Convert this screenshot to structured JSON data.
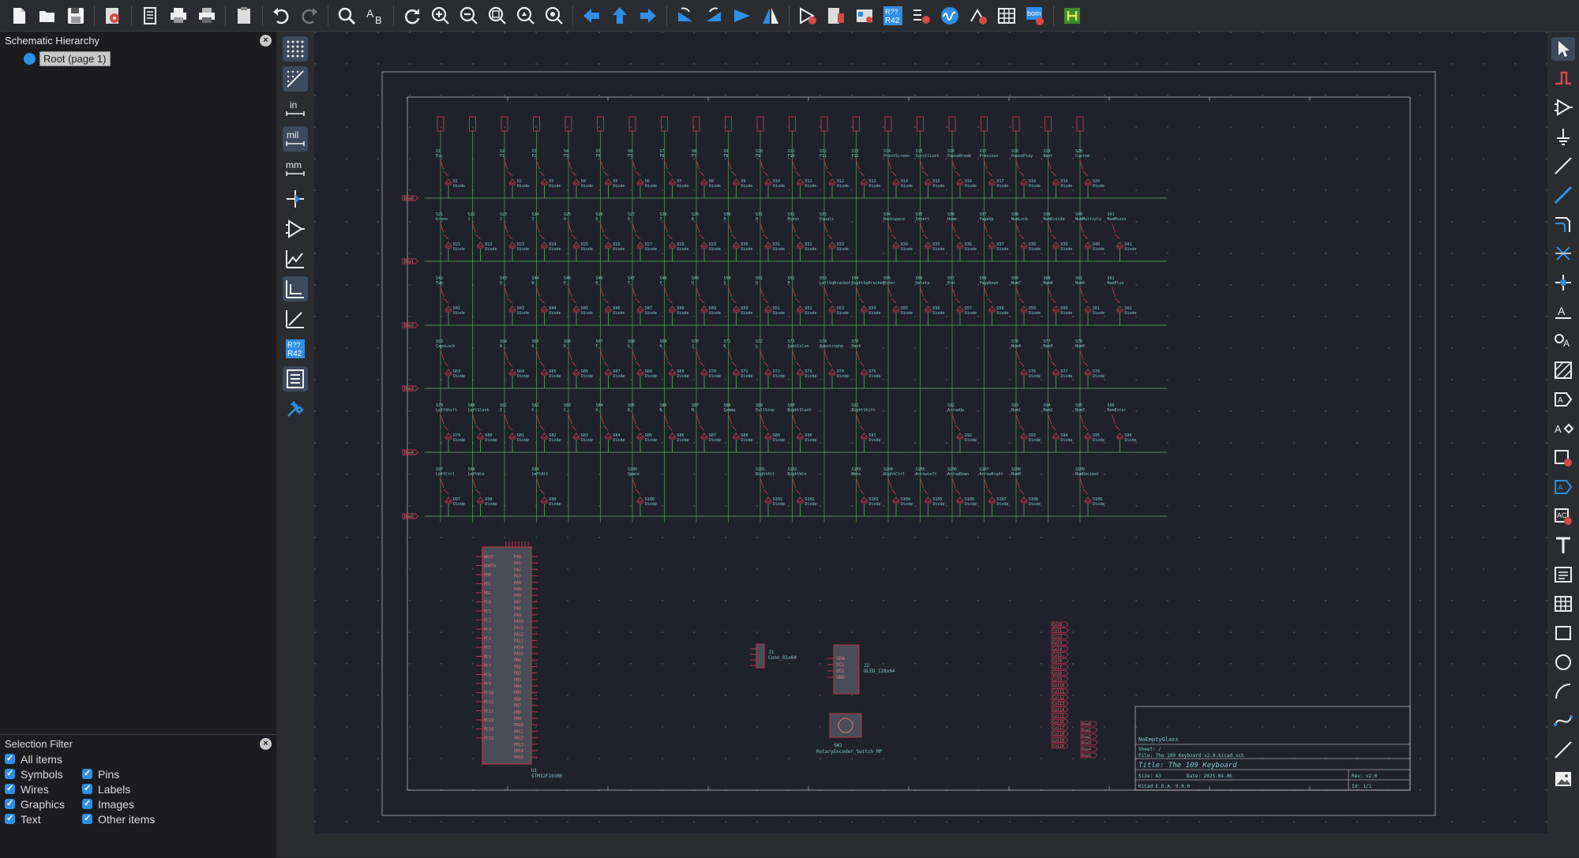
{
  "toolbar": {
    "icons": [
      "new-icon",
      "open-icon",
      "save-icon",
      "schematic-setup-icon",
      "page-settings-icon",
      "print-icon",
      "plot-icon",
      "paste-icon",
      "undo-icon",
      "redo-icon",
      "find-icon",
      "find-replace-icon",
      "refresh-icon",
      "zoom-in-icon",
      "zoom-out-icon",
      "zoom-fit-icon",
      "zoom-objects-icon",
      "zoom-selection-icon",
      "navigate-back-icon",
      "navigate-up-icon",
      "navigate-forward-icon",
      "rotate-ccw-icon",
      "rotate-cw-icon",
      "mirror-vertical-icon",
      "mirror-horizontal-icon",
      "erc-icon",
      "symbol-editor-icon",
      "symbol-browser-icon",
      "annotate-icon",
      "assign-footprints-icon",
      "simulator-icon",
      "pcb-editor-icon",
      "symbol-fields-table-icon",
      "bom-icon",
      "pcbnew-icon"
    ],
    "annotate_text_top": "R??",
    "annotate_text_bottom": "R42",
    "bom_text": "bom"
  },
  "hierarchy": {
    "title": "Schematic Hierarchy",
    "root_label": "Root (page 1)"
  },
  "selection_filter": {
    "title": "Selection Filter",
    "items": [
      "All items",
      "Symbols",
      "Pins",
      "Wires",
      "Labels",
      "Graphics",
      "Images",
      "Text",
      "Other items"
    ]
  },
  "left_tools": {
    "units_in": "in",
    "units_mil": "mil",
    "units_mm": "mm",
    "annotate_top": "R??",
    "annotate_bottom": "R42"
  },
  "schematic": {
    "rows": [
      "Row0",
      "Row1",
      "Row2",
      "Row3",
      "Row4",
      "Row5"
    ],
    "switch_row0": [
      "Esc",
      "F1",
      "F2",
      "F3",
      "F4",
      "F5",
      "F6",
      "F7",
      "F8",
      "F9",
      "F10",
      "F11",
      "F12",
      "PrintScreen",
      "ScrollLock",
      "PauseBreak",
      "Previous",
      "PausePlay",
      "Next",
      "Custom"
    ],
    "switch_row1": [
      "Grave",
      "1",
      "2",
      "3",
      "4",
      "5",
      "6",
      "7",
      "8",
      "9",
      "0",
      "Minus",
      "Equals",
      "Backspace",
      "Insert",
      "Home",
      "PageUp",
      "NumLock",
      "NumDivide",
      "NumMultiply",
      "NumMinus"
    ],
    "switch_row2": [
      "Tab",
      "Q",
      "W",
      "E",
      "R",
      "T",
      "Y",
      "U",
      "I",
      "O",
      "P",
      "LeftSqBracket",
      "RightSqBracket",
      "Enter",
      "Delete",
      "End",
      "PageDown",
      "Num7",
      "Num8",
      "Num9",
      "NumPlus"
    ],
    "switch_row3": [
      "CapsLock",
      "A",
      "S",
      "D",
      "F",
      "G",
      "H",
      "J",
      "K",
      "L",
      "SemiColon",
      "Apostrophe",
      "Hash",
      "Num4",
      "Num5",
      "Num6"
    ],
    "switch_row4": [
      "LeftShift",
      "LeftSlash",
      "Z",
      "X",
      "C",
      "V",
      "B",
      "N",
      "M",
      "Comma",
      "FullStop",
      "RightSlash",
      "RightShift",
      "ArrowUp",
      "Num1",
      "Num2",
      "Num3",
      "NumEnter"
    ],
    "switch_row5": [
      "LeftCtrl",
      "LeftWin",
      "LeftAlt",
      "Space",
      "RightAlt",
      "RightWin",
      "Menu",
      "RightCtrl",
      "ArrowLeft",
      "ArrowDown",
      "ArrowRight",
      "Num0",
      "NumDecimal"
    ],
    "diode_value": "Diode",
    "mcu": {
      "ref": "U1",
      "value": "STM32F103RE",
      "pins_left": [
        "NRST",
        "BOOT0",
        "PD0",
        "PD1",
        "PD2",
        "PC0",
        "PC1",
        "PC2",
        "PC3",
        "PC4",
        "PC5",
        "PC6",
        "PC7",
        "PC8",
        "PC9",
        "PC10",
        "PC11",
        "PC12",
        "PC13",
        "PC14",
        "PC15"
      ],
      "pins_right": [
        "PA0",
        "PA1",
        "PA2",
        "PA3",
        "PA4",
        "PA5",
        "PA6",
        "PA7",
        "PA8",
        "PA9",
        "PA10",
        "PA11",
        "PA12",
        "PA13",
        "PA14",
        "PA15",
        "PB0",
        "PB1",
        "PB2",
        "PB3",
        "PB4",
        "PB5",
        "PB6",
        "PB7",
        "PB8",
        "PB9",
        "PB10",
        "PB11",
        "PB12",
        "PB13",
        "PB14",
        "PB15"
      ]
    },
    "conn": {
      "ref": "J1",
      "value": "Conn_01x04"
    },
    "oled": {
      "ref": "J2",
      "value": "OLED_128x64",
      "pins": [
        "SDA",
        "SCL",
        "VCC",
        "GND"
      ]
    },
    "encoder": {
      "ref": "SW1",
      "value": "RotaryEncoder_Switch_MP"
    },
    "col_labels": [
      "Col0",
      "Col1",
      "Col2",
      "Col3",
      "Col4",
      "Col5",
      "Col6",
      "Col7",
      "Col8",
      "Col9",
      "Col10",
      "Col11",
      "Col12",
      "Col13",
      "Col14",
      "Col15",
      "Col16",
      "Col17",
      "Col18",
      "Col19",
      "Col20"
    ],
    "row_labels": [
      "Row0",
      "Row1",
      "Row2",
      "Row3",
      "Row4",
      "Row5"
    ],
    "title_block": {
      "company": "NoEmptyGlass",
      "sheet": "Sheet: /",
      "file": "File: The 109 Keyboard v2.0.kicad_sch",
      "title": "Title: The 109 Keyboard",
      "size": "Size: A3",
      "date": "Date: 2025-04-06",
      "rev": "Rev: v2.0",
      "tool": "KiCad E.D.A. 9.0.0",
      "id": "Id: 1/1"
    }
  },
  "colors": {
    "bg": "#1e1f23",
    "canvas": "#1f222a",
    "wire": "#5fae5f",
    "symbol": "#b8354a",
    "text": "#7fc8d0",
    "accent": "#2f8fe6"
  }
}
